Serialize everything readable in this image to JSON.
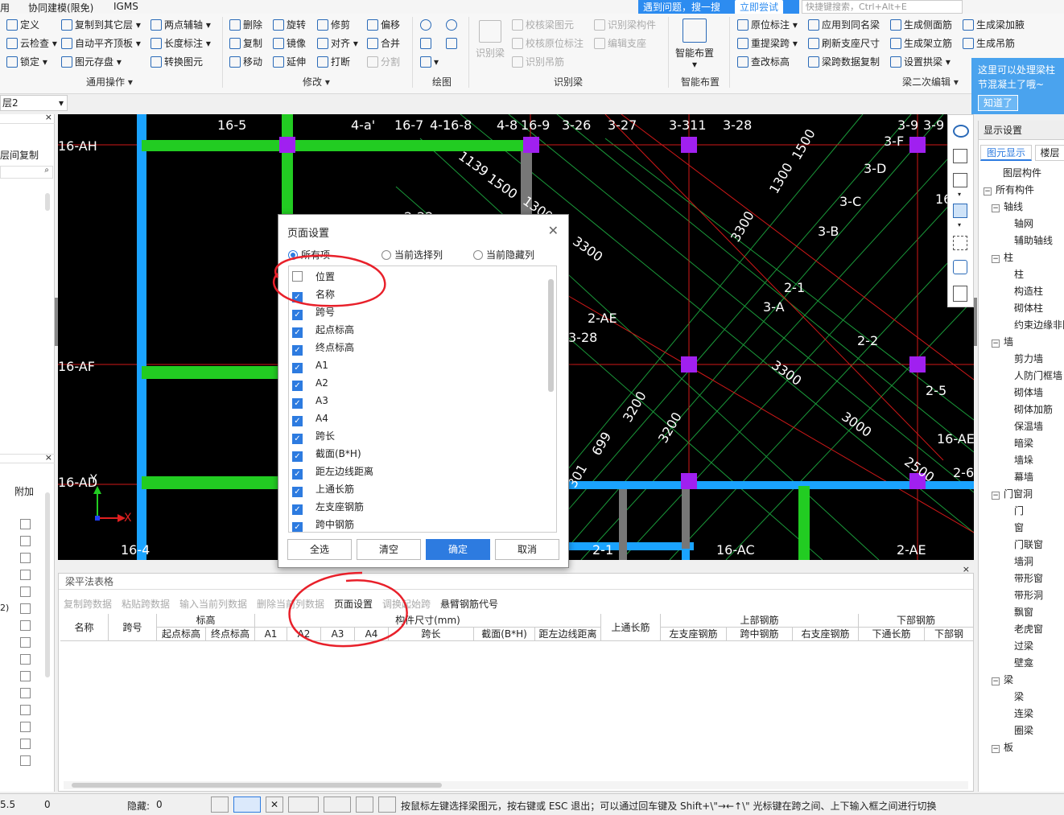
{
  "menubar": {
    "items": [
      "用",
      "协同建模(限免)",
      "IGMS"
    ]
  },
  "banner": {
    "text": "遇到问题，搜一搜",
    "button": "立即尝试"
  },
  "quicksearch": {
    "placeholder": "快捷键搜索，Ctrl+Alt+E"
  },
  "ribbon": {
    "col1": [
      "定义",
      "云检查",
      "锁定"
    ],
    "col2": [
      "复制到其它层",
      "自动平齐顶板",
      "图元存盘"
    ],
    "col3": [
      "两点辅轴",
      "长度标注",
      "转换图元"
    ],
    "group1": "通用操作",
    "col4": [
      "删除",
      "复制",
      "移动"
    ],
    "col5": [
      "旋转",
      "镜像",
      "延伸"
    ],
    "col6": [
      "修剪",
      "对齐",
      "打断"
    ],
    "col7": [
      "偏移",
      "合并",
      "分割"
    ],
    "group2": "修改",
    "group3": "绘图",
    "recog": [
      "识别梁",
      "校核梁图元",
      "校核原位标注",
      "识别吊筋",
      "识别梁构件",
      "编辑支座"
    ],
    "group4": "识别梁",
    "smart": "智能布置",
    "group5": "智能布置",
    "col8": [
      "原位标注",
      "重提梁跨",
      "查改标高"
    ],
    "col9": [
      "应用到同名梁",
      "刷新支座尺寸",
      "梁跨数据复制"
    ],
    "col10": [
      "生成侧面筋",
      "生成架立筋",
      "设置拱梁"
    ],
    "col11": [
      "生成梁加腋",
      "生成吊筋"
    ],
    "group6": "梁二次编辑"
  },
  "tip": {
    "text": "这里可以处理梁柱节混凝土了哦~",
    "button": "知道了"
  },
  "layer": {
    "value": "层2"
  },
  "leftpanel": {
    "copy_label": "层间复制",
    "attach": "附加",
    "num": "2)"
  },
  "canvas_labels": {
    "top": [
      "16-5",
      "4-a'",
      "16-7",
      "4-1",
      "16-8",
      "4-8",
      "16-9",
      "3-26",
      "3-27",
      "3-311",
      "3-28",
      "3-9",
      "3-9"
    ],
    "rows": [
      "16-AH",
      "16-AF",
      "16-AD"
    ],
    "right": [
      "3-F",
      "3-D",
      "3-C",
      "3-B",
      "16",
      "2-1",
      "3-A",
      "2-2",
      "2-5",
      "16-AE",
      "2-6"
    ],
    "dims": [
      "1139",
      "1500",
      "1300",
      "3300",
      "1300",
      "1500",
      "3300",
      "3300",
      "3200",
      "3200",
      "3000",
      "2500",
      "699",
      "301"
    ],
    "mid": [
      "2-AE",
      "3-28",
      "2-22"
    ],
    "bottom": [
      "16-4",
      "2-1",
      "16-AC",
      "2-AE"
    ],
    "axes": [
      "Y",
      "X"
    ]
  },
  "right_panel": {
    "tabs": [
      "显示设置",
      "图元显示",
      "楼层显"
    ],
    "header": "图层构件",
    "tree": [
      {
        "label": "所有构件",
        "level": 0,
        "exp": true
      },
      {
        "label": "轴线",
        "level": 1,
        "exp": true
      },
      {
        "label": "轴网",
        "level": 2
      },
      {
        "label": "辅助轴线",
        "level": 2
      },
      {
        "label": "柱",
        "level": 1,
        "exp": true
      },
      {
        "label": "柱",
        "level": 2
      },
      {
        "label": "构造柱",
        "level": 2
      },
      {
        "label": "砌体柱",
        "level": 2
      },
      {
        "label": "约束边缘非阴",
        "level": 2
      },
      {
        "label": "墙",
        "level": 1,
        "exp": true
      },
      {
        "label": "剪力墙",
        "level": 2
      },
      {
        "label": "人防门框墙",
        "level": 2
      },
      {
        "label": "砌体墙",
        "level": 2
      },
      {
        "label": "砌体加筋",
        "level": 2
      },
      {
        "label": "保温墙",
        "level": 2
      },
      {
        "label": "暗梁",
        "level": 2
      },
      {
        "label": "墙垛",
        "level": 2
      },
      {
        "label": "幕墙",
        "level": 2
      },
      {
        "label": "门窗洞",
        "level": 1,
        "exp": true
      },
      {
        "label": "门",
        "level": 2
      },
      {
        "label": "窗",
        "level": 2
      },
      {
        "label": "门联窗",
        "level": 2
      },
      {
        "label": "墙洞",
        "level": 2
      },
      {
        "label": "带形窗",
        "level": 2
      },
      {
        "label": "带形洞",
        "level": 2
      },
      {
        "label": "飘窗",
        "level": 2
      },
      {
        "label": "老虎窗",
        "level": 2
      },
      {
        "label": "过梁",
        "level": 2
      },
      {
        "label": "壁龛",
        "level": 2
      },
      {
        "label": "梁",
        "level": 1,
        "exp": true
      },
      {
        "label": "梁",
        "level": 2
      },
      {
        "label": "连梁",
        "level": 2
      },
      {
        "label": "圈梁",
        "level": 2
      },
      {
        "label": "板",
        "level": 1,
        "exp": true
      }
    ]
  },
  "bottom": {
    "title": "梁平法表格",
    "toolbar": [
      "复制跨数据",
      "粘贴跨数据",
      "输入当前列数据",
      "删除当前列数据",
      "页面设置",
      "调换起始跨",
      "悬臂钢筋代号"
    ],
    "headers": {
      "name": "名称",
      "span": "跨号",
      "elev": "标高",
      "start_elev": "起点标高",
      "end_elev": "终点标高",
      "size": "构件尺寸(mm)",
      "a1": "A1",
      "a2": "A2",
      "a3": "A3",
      "a4": "A4",
      "span_len": "跨长",
      "section": "截面(B*H)",
      "edge_dist": "距左边线距离",
      "top_through": "上通长筋",
      "top_bar": "上部钢筋",
      "left_seat": "左支座钢筋",
      "mid_span": "跨中钢筋",
      "right_seat": "右支座钢筋",
      "bot_bar": "下部钢筋",
      "bot_through": "下通长筋",
      "bot_bar2": "下部钢"
    }
  },
  "status": {
    "coord": "5.5",
    "zero": "0",
    "hidden_label": "隐藏:",
    "hidden_value": "0",
    "hint": "按鼠标左键选择梁图元，按右键或 ESC 退出；可以通过回车键及 Shift+\\\"→←↑\\\" 光标键在跨之间、上下输入框之间进行切换"
  },
  "dialog": {
    "title": "页面设置",
    "radios": [
      "所有项",
      "当前选择列",
      "当前隐藏列"
    ],
    "items": [
      {
        "label": "位置",
        "checked": false
      },
      {
        "label": "名称",
        "checked": true
      },
      {
        "label": "跨号",
        "checked": true
      },
      {
        "label": "起点标高",
        "checked": true
      },
      {
        "label": "终点标高",
        "checked": true
      },
      {
        "label": "A1",
        "checked": true
      },
      {
        "label": "A2",
        "checked": true
      },
      {
        "label": "A3",
        "checked": true
      },
      {
        "label": "A4",
        "checked": true
      },
      {
        "label": "跨长",
        "checked": true
      },
      {
        "label": "截面(B*H)",
        "checked": true
      },
      {
        "label": "距左边线距离",
        "checked": true
      },
      {
        "label": "上通长筋",
        "checked": true
      },
      {
        "label": "左支座钢筋",
        "checked": true
      },
      {
        "label": "跨中钢筋",
        "checked": true
      }
    ],
    "buttons": [
      "全选",
      "清空",
      "确定",
      "取消"
    ]
  },
  "colors": {
    "accent": "#2d7be0",
    "annotation": "#e8202a",
    "beam_green": "#22cc22",
    "beam_blue": "#1aa3ff",
    "column": "#a020f0"
  }
}
